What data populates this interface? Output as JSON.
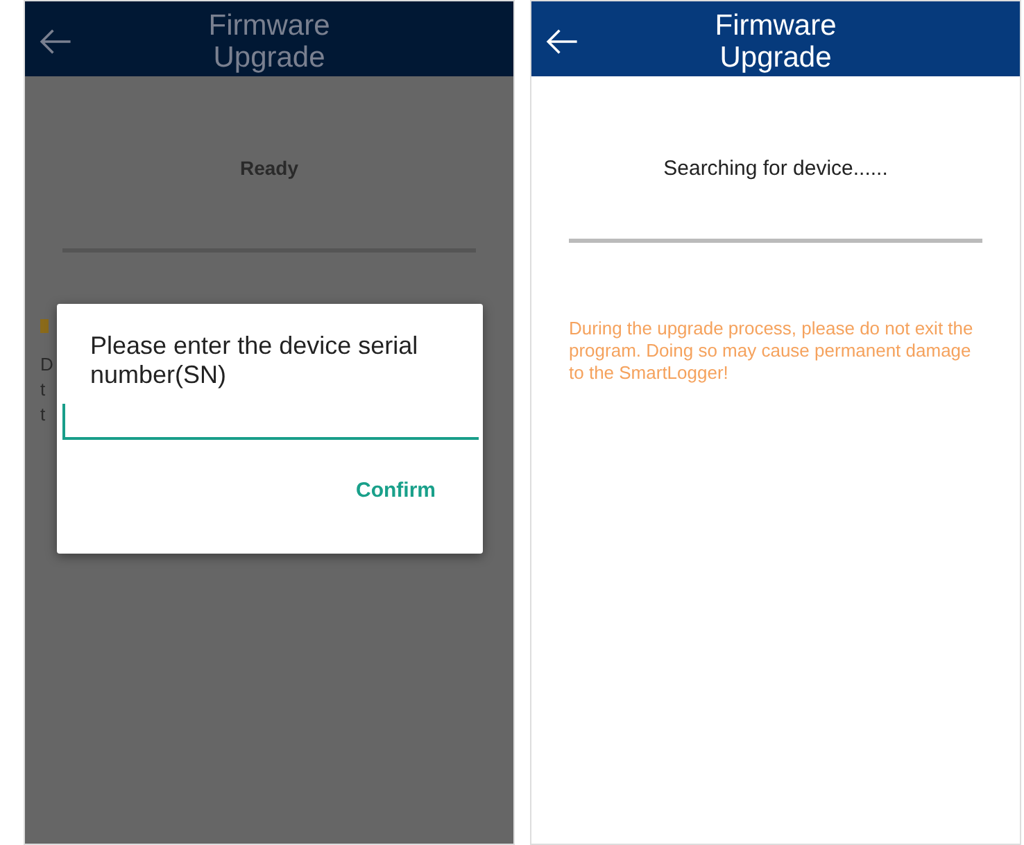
{
  "screens": [
    {
      "dimmed": true,
      "header": {
        "title": "Firmware Upgrade"
      },
      "status": "Ready",
      "covered_text_fragments": [
        "D",
        "t",
        "t"
      ],
      "dialog": {
        "title": "Please enter the device serial number(SN)",
        "buttons": [
          "Confirm"
        ]
      }
    },
    {
      "dimmed": false,
      "header": {
        "title": "Firmware Upgrade"
      },
      "status": "Searching for device......",
      "warning": "During the upgrade process, please do not exit the program. Doing so may cause permanent damage to the SmartLogger!"
    }
  ]
}
